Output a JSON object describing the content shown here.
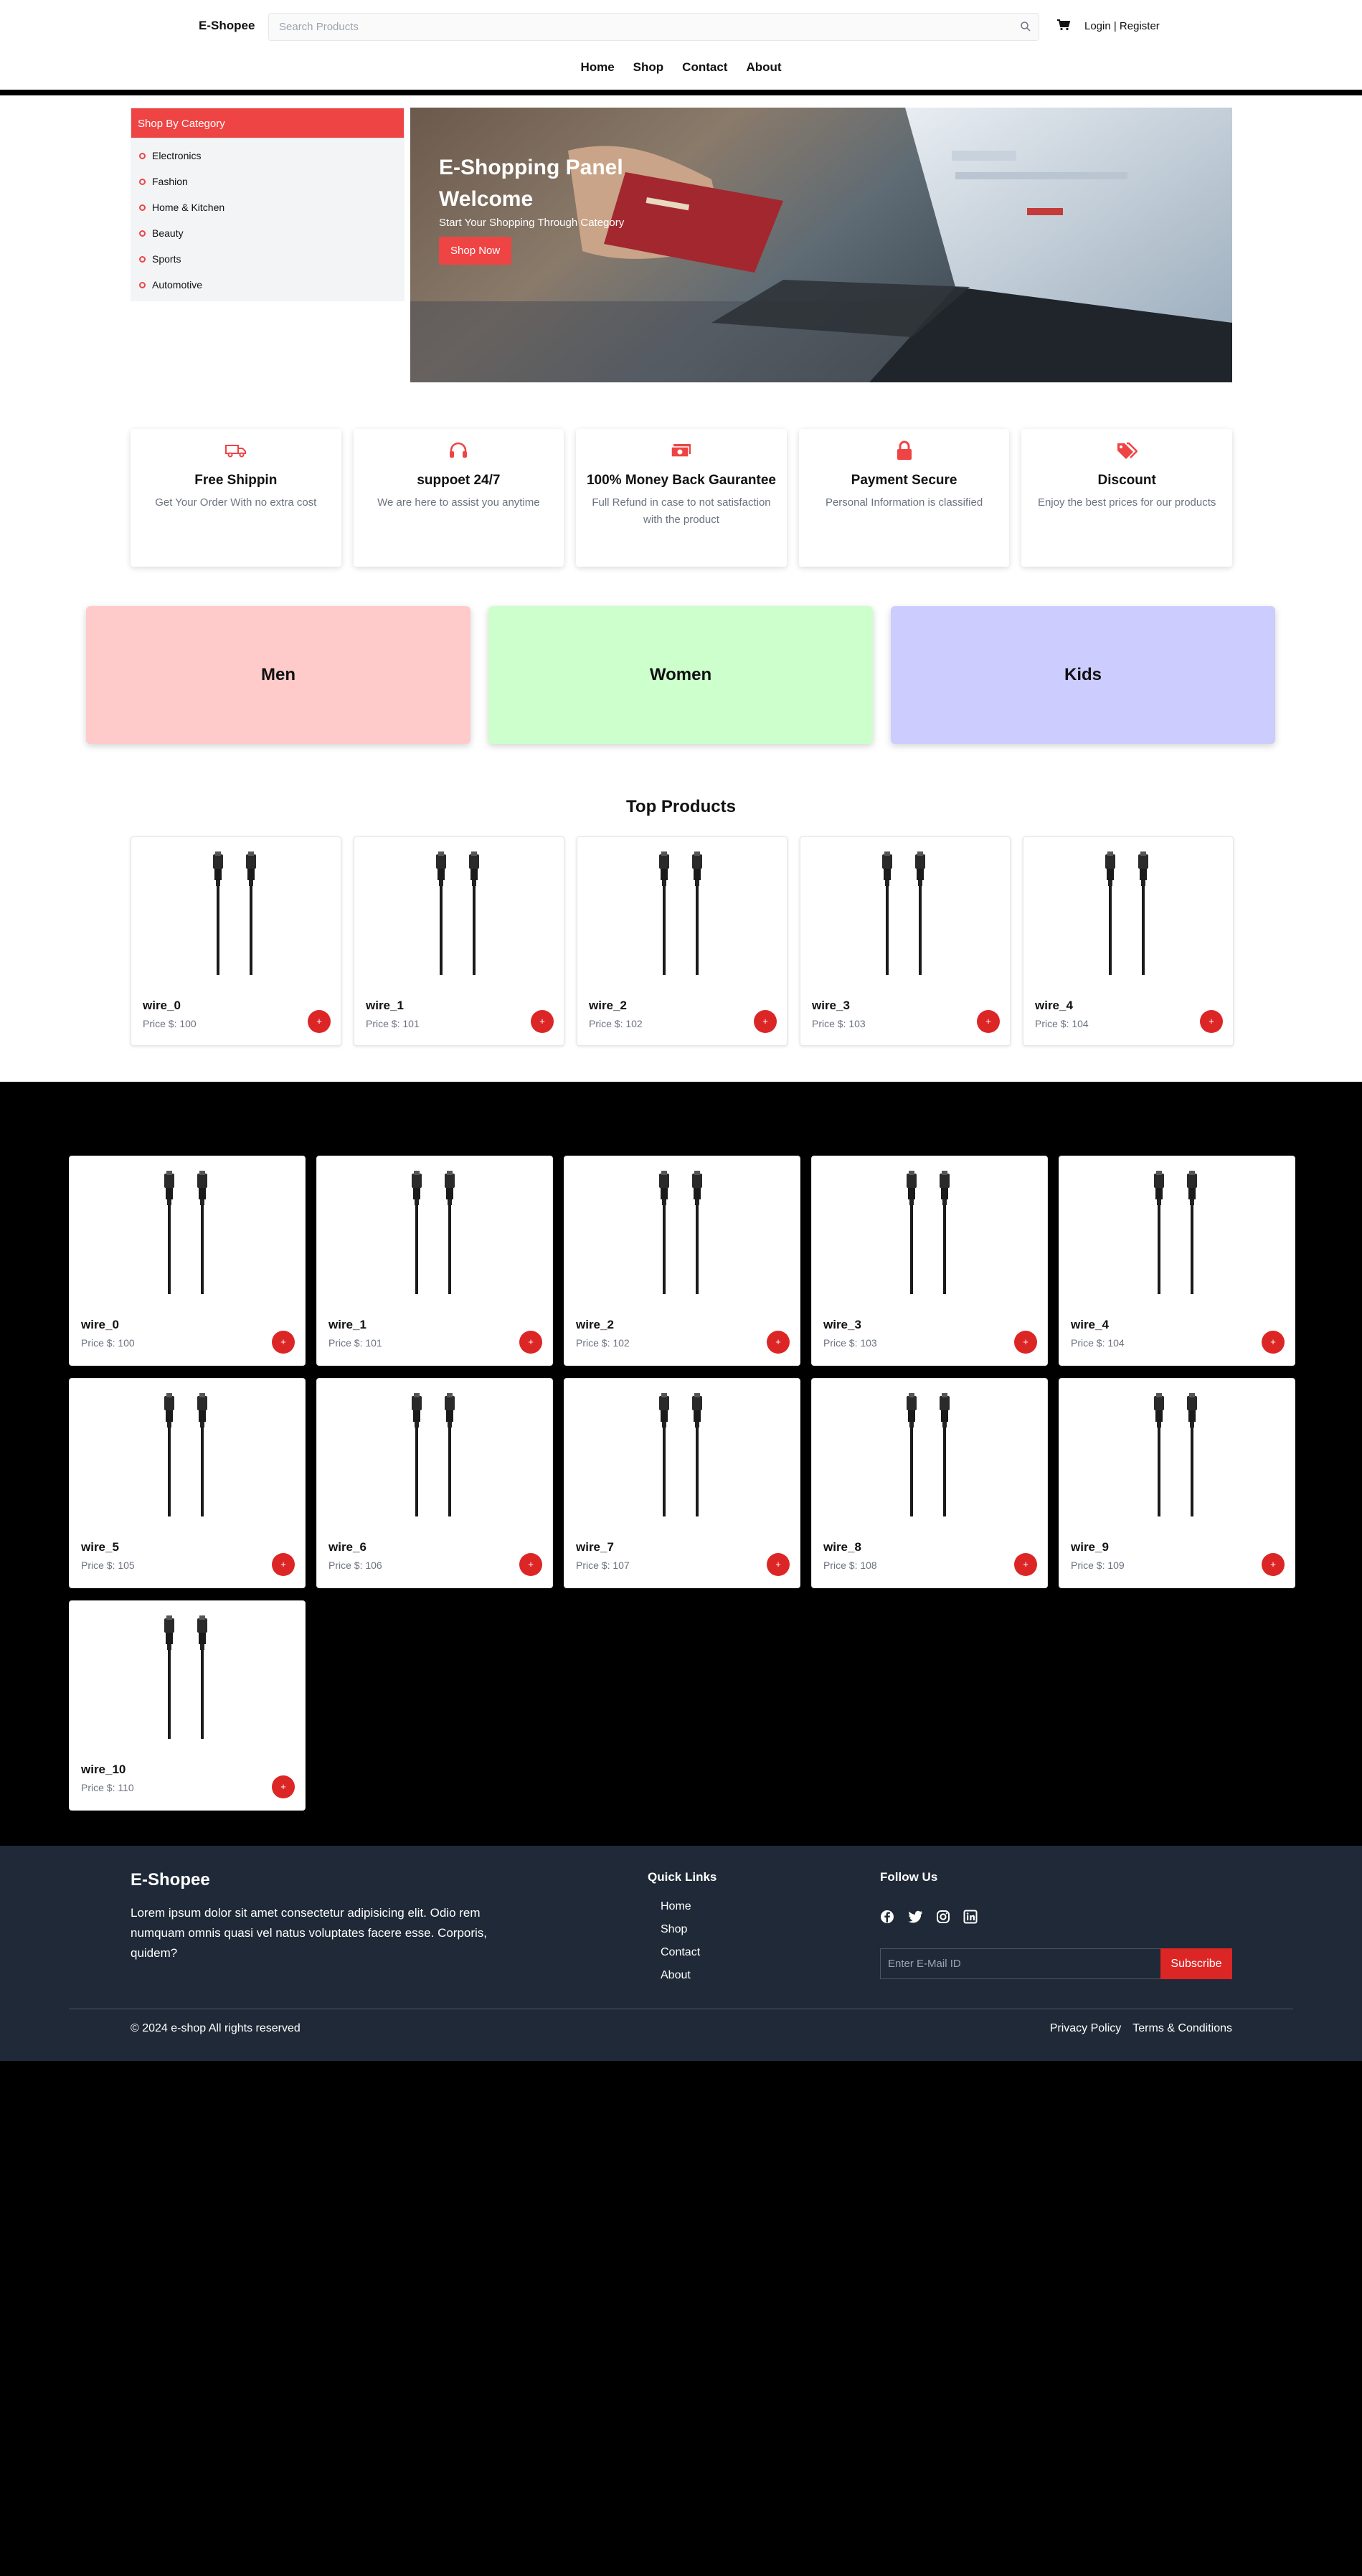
{
  "header": {
    "brand": "E-Shopee",
    "search_placeholder": "Search Products",
    "auth": "Login | Register",
    "nav": [
      "Home",
      "Shop",
      "Contact",
      "About"
    ]
  },
  "categories": {
    "heading": "Shop By Category",
    "items": [
      "Electronics",
      "Fashion",
      "Home & Kitchen",
      "Beauty",
      "Sports",
      "Automotive"
    ]
  },
  "hero": {
    "title": "E-Shopping Panel Welcome",
    "subtitle": "Start Your Shopping Through Category",
    "button": "Shop Now"
  },
  "features": [
    {
      "icon": "truck-icon",
      "title": "Free Shippin",
      "desc": "Get Your Order With no extra cost"
    },
    {
      "icon": "headphones-icon",
      "title": "suppoet 24/7",
      "desc": "We are here to assist you anytime"
    },
    {
      "icon": "money-icon",
      "title": "100% Money Back Gaurantee",
      "desc": "Full Refund in case to not satisfaction with the product"
    },
    {
      "icon": "lock-icon",
      "title": "Payment Secure",
      "desc": "Personal Information is classified"
    },
    {
      "icon": "tags-icon",
      "title": "Discount",
      "desc": "Enjoy the best prices for our products"
    }
  ],
  "genders": [
    {
      "label": "Men",
      "color": "#fecaca"
    },
    {
      "label": "Women",
      "color": "#ccffcc"
    },
    {
      "label": "Kids",
      "color": "#ccccff"
    }
  ],
  "top_products": {
    "title": "Top Products",
    "items": [
      {
        "name": "wire_0",
        "price": "Price $: 100"
      },
      {
        "name": "wire_1",
        "price": "Price $: 101"
      },
      {
        "name": "wire_2",
        "price": "Price $: 102"
      },
      {
        "name": "wire_3",
        "price": "Price $: 103"
      },
      {
        "name": "wire_4",
        "price": "Price $: 104"
      }
    ]
  },
  "shop_products": [
    {
      "name": "wire_0",
      "price": "Price $: 100"
    },
    {
      "name": "wire_1",
      "price": "Price $: 101"
    },
    {
      "name": "wire_2",
      "price": "Price $: 102"
    },
    {
      "name": "wire_3",
      "price": "Price $: 103"
    },
    {
      "name": "wire_4",
      "price": "Price $: 104"
    },
    {
      "name": "wire_5",
      "price": "Price $: 105"
    },
    {
      "name": "wire_6",
      "price": "Price $: 106"
    },
    {
      "name": "wire_7",
      "price": "Price $: 107"
    },
    {
      "name": "wire_8",
      "price": "Price $: 108"
    },
    {
      "name": "wire_9",
      "price": "Price $: 109"
    },
    {
      "name": "wire_10",
      "price": "Price $: 110"
    }
  ],
  "add_button": "+",
  "footer": {
    "brand": "E-Shopee",
    "description": "Lorem ipsum dolor sit amet consectetur adipisicing elit. Odio rem numquam omnis quasi vel natus voluptates facere esse. Corporis, quidem?",
    "quick_links_heading": "Quick Links",
    "quick_links": [
      "Home",
      "Shop",
      "Contact",
      "About"
    ],
    "follow_heading": "Follow Us",
    "social_icons": [
      "facebook-icon",
      "twitter-icon",
      "instagram-icon",
      "linkedin-icon"
    ],
    "email_placeholder": "Enter E-Mail ID",
    "subscribe": "Subscribe",
    "copyright": "© 2024 e-shop All rights reserved",
    "legal": [
      "Privacy Policy",
      "Terms & Conditions"
    ]
  },
  "colors": {
    "accent": "#ef4444",
    "accent_dark": "#dc2626",
    "footer_bg": "#1f2937",
    "page_bg": "#000000"
  }
}
